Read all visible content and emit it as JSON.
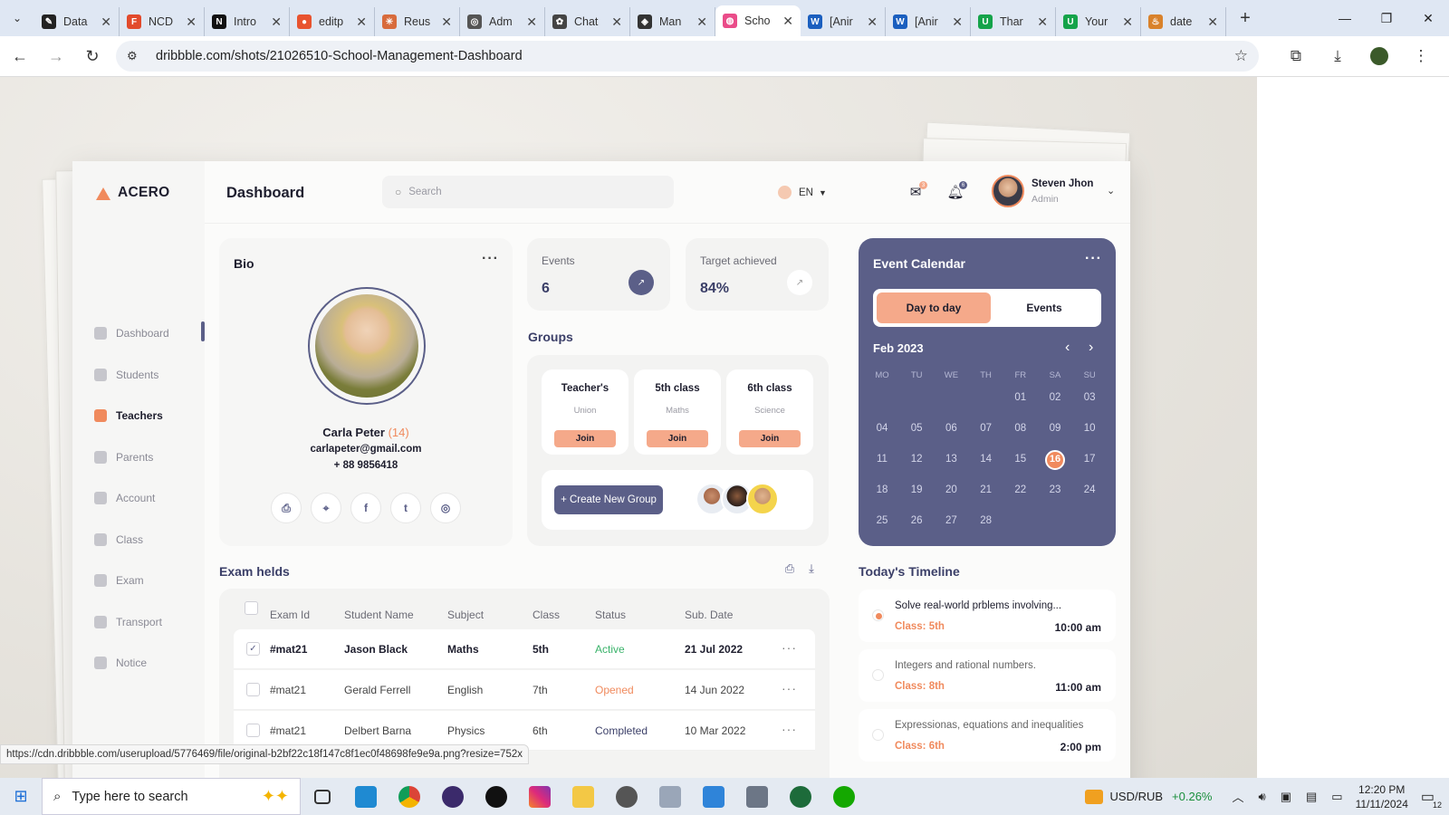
{
  "browser": {
    "tabs": [
      {
        "label": "Data",
        "color": "#222222",
        "glyph": "✎"
      },
      {
        "label": "NCD",
        "color": "#e24a2c",
        "glyph": "F"
      },
      {
        "label": "Intro",
        "color": "#111111",
        "glyph": "N"
      },
      {
        "label": "editp",
        "color": "#e8532f",
        "glyph": "●"
      },
      {
        "label": "Reus",
        "color": "#d86b3c",
        "glyph": "✳"
      },
      {
        "label": "Adm",
        "color": "#555555",
        "glyph": "◎"
      },
      {
        "label": "Chat",
        "color": "#444444",
        "glyph": "✿"
      },
      {
        "label": "Man",
        "color": "#333333",
        "glyph": "◈"
      },
      {
        "label": "Scho",
        "color": "#ea4c89",
        "glyph": "◍",
        "active": true
      },
      {
        "label": "[Anir",
        "color": "#1b5fbf",
        "glyph": "W"
      },
      {
        "label": "[Anir",
        "color": "#1b5fbf",
        "glyph": "W"
      },
      {
        "label": "Thar",
        "color": "#15a34a",
        "glyph": "U"
      },
      {
        "label": "Your",
        "color": "#15a34a",
        "glyph": "U"
      },
      {
        "label": "date",
        "color": "#d9822b",
        "glyph": "♨"
      }
    ],
    "url": "dribbble.com/shots/21026510-School-Management-Dashboard",
    "status_url": "https://cdn.dribbble.com/userupload/5776469/file/original-b2bf22c18f147c8f1ec0f48698fe9e9a.png?resize=752x"
  },
  "app": {
    "brand": "ACERO",
    "page_title": "Dashboard",
    "search_placeholder": "Search",
    "language": "EN",
    "mail_badge": "3",
    "notif_badge": "6",
    "user": {
      "name": "Steven Jhon",
      "role": "Admin"
    },
    "nav": [
      {
        "label": "Dashboard",
        "icon": "grid-icon"
      },
      {
        "label": "Students",
        "icon": "student-icon"
      },
      {
        "label": "Teachers",
        "icon": "teacher-icon",
        "active": true
      },
      {
        "label": "Parents",
        "icon": "parents-icon"
      },
      {
        "label": "Account",
        "icon": "account-icon"
      },
      {
        "label": "Class",
        "icon": "class-icon"
      },
      {
        "label": "Exam",
        "icon": "exam-icon"
      },
      {
        "label": "Transport",
        "icon": "bus-icon"
      },
      {
        "label": "Notice",
        "icon": "notice-icon"
      }
    ],
    "bio": {
      "title": "Bio",
      "name": "Carla Peter",
      "age": "(14)",
      "email": "carlapeter@gmail.com",
      "phone": "+ 88 9856418",
      "socials": [
        "printer-icon",
        "location-icon",
        "facebook-icon",
        "twitter-icon",
        "instagram-icon"
      ]
    },
    "stats": [
      {
        "label": "Events",
        "value": "6"
      },
      {
        "label": "Target achieved",
        "value": "84%"
      }
    ],
    "groups": {
      "title": "Groups",
      "items": [
        {
          "title": "Teacher's",
          "sub": "Union",
          "join": "Join"
        },
        {
          "title": "5th class",
          "sub": "Maths",
          "join": "Join"
        },
        {
          "title": "6th class",
          "sub": "Science",
          "join": "Join"
        }
      ],
      "create_label": "+ Create New Group"
    },
    "calendar": {
      "title": "Event Calendar",
      "tab_a": "Day to day",
      "tab_b": "Events",
      "month": "Feb 2023",
      "dow": [
        "MO",
        "TU",
        "WE",
        "TH",
        "FR",
        "SA",
        "SU"
      ],
      "lead_blanks": 4,
      "days": [
        "01",
        "02",
        "03",
        "04",
        "05",
        "06",
        "07",
        "08",
        "09",
        "10",
        "11",
        "12",
        "13",
        "14",
        "15",
        "16",
        "17",
        "18",
        "19",
        "20",
        "21",
        "22",
        "23",
        "24",
        "25",
        "26",
        "27",
        "28"
      ],
      "today": "16"
    },
    "timeline": {
      "title": "Today's Timeline",
      "items": [
        {
          "text": "Solve real-world prblems involving...",
          "class": "Class: 5th",
          "time": "10:00 am",
          "active": true
        },
        {
          "text": "Integers and rational numbers.",
          "class": "Class: 8th",
          "time": "11:00 am",
          "active": false
        },
        {
          "text": "Expressionas, equations and inequalities",
          "class": "Class: 6th",
          "time": "2:00 pm",
          "active": false
        }
      ]
    },
    "exams": {
      "title": "Exam helds",
      "headers": [
        "Exam Id",
        "Student Name",
        "Subject",
        "Class",
        "Status",
        "Sub. Date"
      ],
      "rows": [
        {
          "id": "#mat21",
          "name": "Jason Black",
          "subject": "Maths",
          "class": "5th",
          "status": "Active",
          "status_color": "#3bb36b",
          "date": "21 Jul 2022",
          "checked": true
        },
        {
          "id": "#mat21",
          "name": "Gerald Ferrell",
          "subject": "English",
          "class": "7th",
          "status": "Opened",
          "status_color": "#f08a5d",
          "date": "14 Jun 2022",
          "checked": false
        },
        {
          "id": "#mat21",
          "name": "Delbert Barna",
          "subject": "Physics",
          "class": "6th",
          "status": "Completed",
          "status_color": "#3b3f68",
          "date": "10 Mar 2022",
          "checked": false
        }
      ]
    }
  },
  "taskbar": {
    "search_placeholder": "Type here to search",
    "ticker": "USD/RUB",
    "ticker_change": "+0.26%",
    "time": "12:20 PM",
    "date": "11/11/2024",
    "notif_count": "12"
  }
}
